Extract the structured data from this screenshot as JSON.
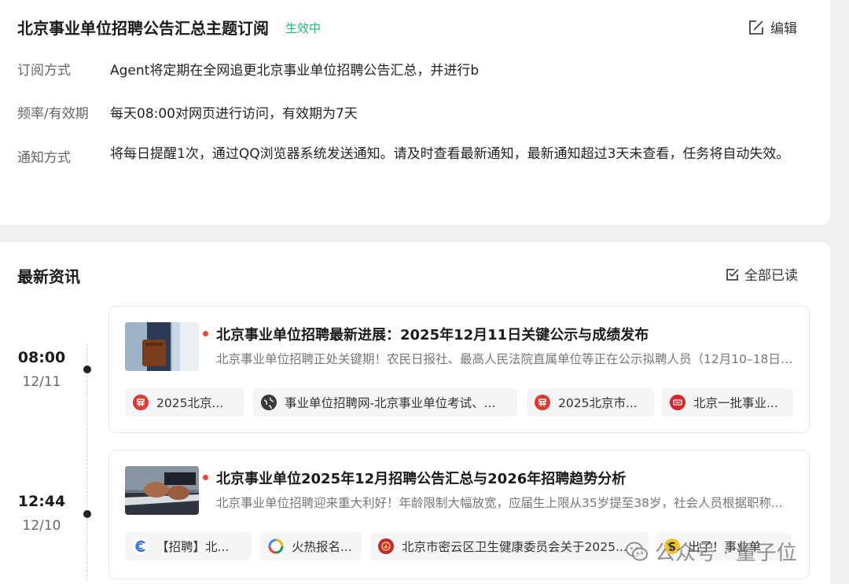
{
  "subscription": {
    "title": "北京事业单位招聘公告汇总主题订阅",
    "status": "生效中",
    "edit_label": "编辑",
    "rows": [
      {
        "key": "订阅方式",
        "value": "Agent将定期在全网追更北京事业单位招聘公告汇总，并进行b"
      },
      {
        "key": "频率/有效期",
        "value": "每天08:00对网页进行访问，有效期为7天"
      },
      {
        "key": "通知方式",
        "value": "将每日提醒1次，通过QQ浏览器系统发送通知。请及时查看最新通知，最新通知超过3天未查看，任务将自动失效。"
      }
    ]
  },
  "news_section": {
    "title": "最新资讯",
    "mark_all_read": "全部已读",
    "items": [
      {
        "time": "08:00",
        "date": "12/11",
        "title": "北京事业单位招聘最新进展：2025年12月11日关键公示与成绩发布",
        "summary": "北京事业单位招聘正处关键期！农民日报社、最高人民法院直属单位等正在公示拟聘人员（12月10–18日）...",
        "sources": [
          {
            "label": "2025北京...",
            "icon": "china-edu-icon"
          },
          {
            "label": "事业单位招聘网-北京事业单位考试、...",
            "icon": "globe-icon"
          },
          {
            "label": "2025北京市...",
            "icon": "china-edu-icon"
          },
          {
            "label": "北京一批事业...",
            "icon": "news-app-icon"
          }
        ]
      },
      {
        "time": "12:44",
        "date": "12/10",
        "title": "北京事业单位2025年12月招聘公告汇总与2026年招聘趋势分析",
        "summary": "北京事业单位招聘迎来重大利好！年龄限制大幅放宽，应届生上限从35岁提至38岁，社会人员根据职称...",
        "sources": [
          {
            "label": "【招聘】北...",
            "icon": "c-logo-icon"
          },
          {
            "label": "火热报名...",
            "icon": "colorful-ring-icon"
          },
          {
            "label": "北京市密云区卫生健康委员会关于2025...",
            "icon": "gov-emblem-icon"
          },
          {
            "label": "出了！事业单",
            "icon": "s-logo-icon"
          }
        ]
      }
    ]
  },
  "watermark": {
    "text": "公众号 · 量子位"
  },
  "colors": {
    "status_green": "#22b573",
    "dot_red": "#e5483b",
    "background": "#f0f1f3"
  }
}
